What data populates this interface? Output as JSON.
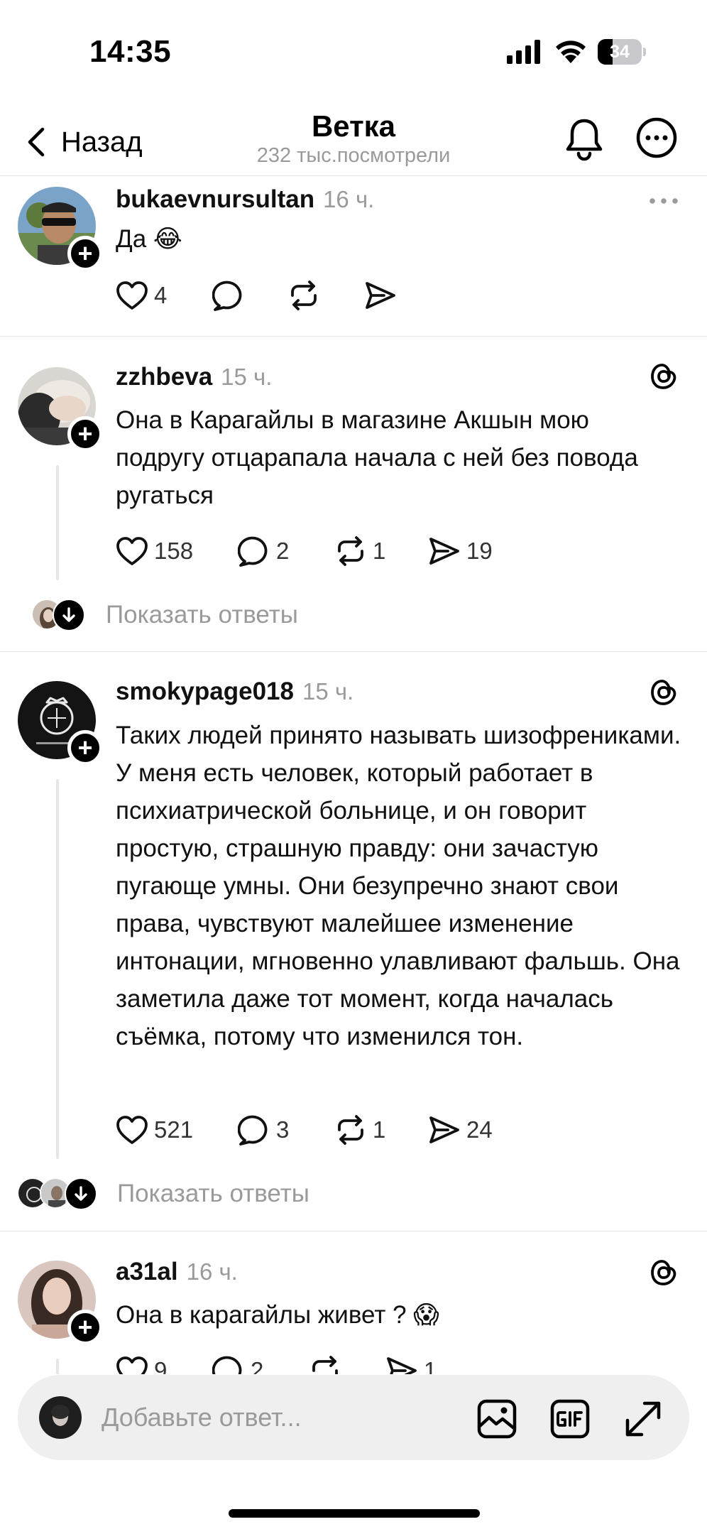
{
  "status_bar": {
    "time": "14:35",
    "battery": "34",
    "battery_level_percent": 34
  },
  "header": {
    "back_label": "Назад",
    "title": "Ветка",
    "subtitle": "232 тыс.посмотрели"
  },
  "posts": [
    {
      "username": "bukaevnursultan",
      "time": "16 ч.",
      "text": "Да 😂",
      "likes": "4",
      "replies": "",
      "reposts": "",
      "shares": ""
    },
    {
      "username": "zzhbeva",
      "time": "15 ч.",
      "text": "Она в Карагайлы в магазине Акшын мою подругу отцарапала начала с ней без повода ругаться",
      "likes": "158",
      "replies": "2",
      "reposts": "1",
      "shares": "19",
      "show_replies": "Показать ответы"
    },
    {
      "username": "smokypage018",
      "time": "15 ч.",
      "text": "Таких людей принято называть шизофрениками. У меня есть человек, который работает в психиатрической больнице, и он говорит простую, страшную правду: они зачастую пугающе умны. Они безупречно знают свои права, чувствуют малейшее изменение интонации, мгновенно улавливают фальшь. Она заметила даже тот момент, когда началась съёмка, потому что изменился тон.",
      "likes": "521",
      "replies": "3",
      "reposts": "1",
      "shares": "24",
      "show_replies": "Показать ответы"
    },
    {
      "username": "a31al",
      "time": "16 ч.",
      "text": "Она в карагайлы живет ? 😱",
      "likes": "9",
      "replies": "2",
      "reposts": "",
      "shares": "1"
    }
  ],
  "composer": {
    "placeholder": "Добавьте ответ..."
  },
  "icons": [
    "chevron-left-icon",
    "bell-icon",
    "more-icon",
    "heart-icon",
    "comment-icon",
    "repost-icon",
    "share-icon",
    "threads-icon",
    "image-icon",
    "gif-icon",
    "expand-icon"
  ]
}
